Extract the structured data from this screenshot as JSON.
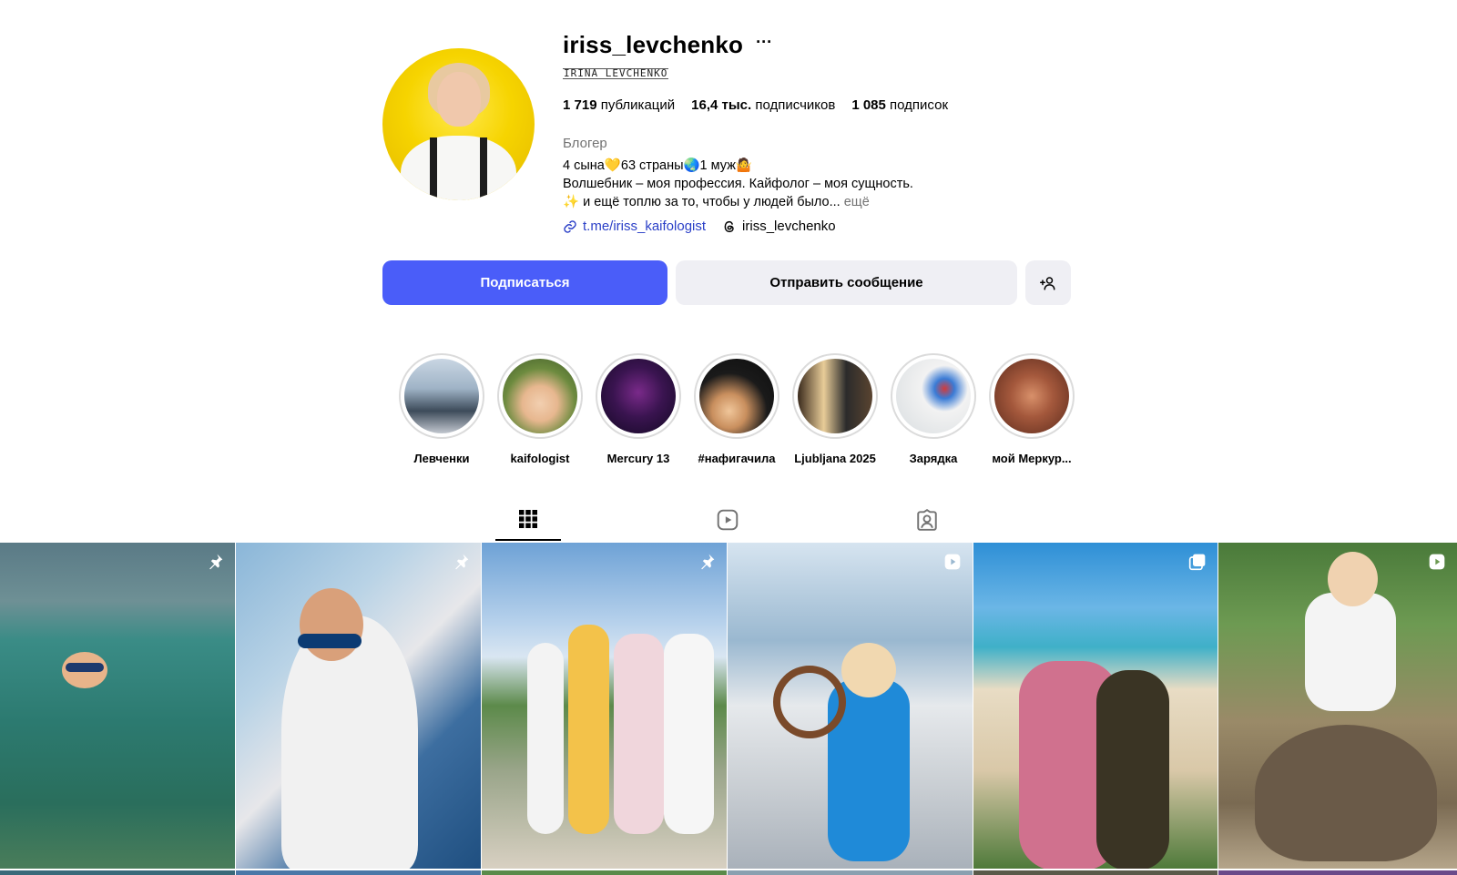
{
  "profile": {
    "username": "iriss_levchenko",
    "more_label": "···",
    "full_name": "IRINA LEVCHENKO",
    "stats": {
      "posts_count": "1 719",
      "posts_label": "публикаций",
      "followers_count": "16,4 тыс.",
      "followers_label": "подписчиков",
      "following_count": "1 085",
      "following_label": "подписок"
    },
    "category": "Блогер",
    "bio_line1": "4 сына💛63 страны🌏1 муж🤷",
    "bio_line2": "Волшебник – моя профессия. Кайфолог – моя сущность.",
    "bio_line3": "✨ и ещё топлю за то, чтобы у людей было...",
    "bio_more": "ещё",
    "link_text": "t.me/iriss_kaifologist",
    "threads_handle": "iriss_levchenko"
  },
  "actions": {
    "follow_label": "Подписаться",
    "message_label": "Отправить сообщение"
  },
  "highlights": [
    {
      "label": "Левченки"
    },
    {
      "label": "kaifologist"
    },
    {
      "label": "Mercury 13"
    },
    {
      "label": "#нафигачила"
    },
    {
      "label": "Ljubljana 2025"
    },
    {
      "label": "Зарядка"
    },
    {
      "label": "мой Меркур..."
    }
  ],
  "tabs": [
    {
      "icon": "grid-icon",
      "active": true
    },
    {
      "icon": "reels-icon",
      "active": false
    },
    {
      "icon": "tagged-icon",
      "active": false
    }
  ],
  "posts": [
    {
      "badge": "pin-icon"
    },
    {
      "badge": "pin-icon"
    },
    {
      "badge": "pin-icon"
    },
    {
      "badge": "reel-icon"
    },
    {
      "badge": "carousel-icon"
    },
    {
      "badge": "reel-icon"
    }
  ],
  "colors": {
    "accent": "#4a5df9",
    "link": "#2a3fc7",
    "secondary_text": "#737373",
    "button_grey": "#efeff4"
  }
}
